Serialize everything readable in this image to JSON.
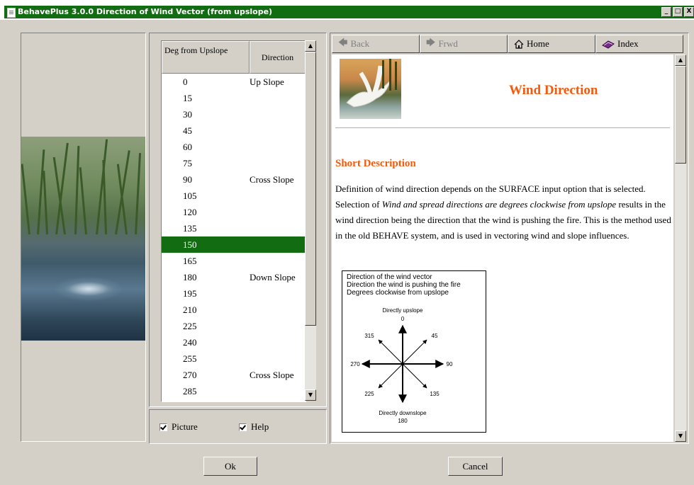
{
  "window": {
    "title": "BehavePlus 3.0.0 Direction of Wind Vector (from upslope)",
    "controls": [
      "_",
      "□",
      "X"
    ]
  },
  "list": {
    "header_deg": "Deg from Upslope",
    "header_dir": "Direction",
    "rows": [
      {
        "deg": "0",
        "dir": "Up Slope"
      },
      {
        "deg": "15",
        "dir": ""
      },
      {
        "deg": "30",
        "dir": ""
      },
      {
        "deg": "45",
        "dir": ""
      },
      {
        "deg": "60",
        "dir": ""
      },
      {
        "deg": "75",
        "dir": ""
      },
      {
        "deg": "90",
        "dir": "Cross Slope"
      },
      {
        "deg": "105",
        "dir": ""
      },
      {
        "deg": "120",
        "dir": ""
      },
      {
        "deg": "135",
        "dir": ""
      },
      {
        "deg": "150",
        "dir": ""
      },
      {
        "deg": "165",
        "dir": ""
      },
      {
        "deg": "180",
        "dir": "Down Slope"
      },
      {
        "deg": "195",
        "dir": ""
      },
      {
        "deg": "210",
        "dir": ""
      },
      {
        "deg": "225",
        "dir": ""
      },
      {
        "deg": "240",
        "dir": ""
      },
      {
        "deg": "255",
        "dir": ""
      },
      {
        "deg": "270",
        "dir": "Cross Slope"
      },
      {
        "deg": "285",
        "dir": ""
      }
    ],
    "selected_deg": "150"
  },
  "checks": {
    "picture_label": "Picture",
    "picture_checked": true,
    "help_label": "Help",
    "help_checked": true
  },
  "nav": {
    "back": "Back",
    "forward": "Frwd",
    "home": "Home",
    "index": "Index"
  },
  "help": {
    "title": "Wind Direction",
    "section": "Short Description",
    "para_1": "Definition of wind direction depends on the SURFACE input option that is selected. Selection of ",
    "para_italic": "Wind and spread directions are degrees clockwise from upslope",
    "para_2": " results in the wind direction being the direction that the wind is pushing the fire. This is the method used in the old BEHAVE system, and is used in vectoring wind and slope influences.",
    "figure": {
      "line1": "Direction of the wind vector",
      "line2": "Direction the wind is pushing the fire",
      "line3": "Degrees clockwise from upslope",
      "top": "Directly upslope",
      "bottom": "Directly downslope",
      "angles": {
        "a0": "0",
        "a45": "45",
        "a90": "90",
        "a135": "135",
        "a180": "180",
        "a225": "225",
        "a270": "270",
        "a315": "315"
      }
    }
  },
  "buttons": {
    "ok": "Ok",
    "cancel": "Cancel"
  },
  "colors": {
    "title_bar": "#126c12",
    "selection": "#126c12",
    "heading": "#f25a0e",
    "face": "#d4d0c8"
  }
}
